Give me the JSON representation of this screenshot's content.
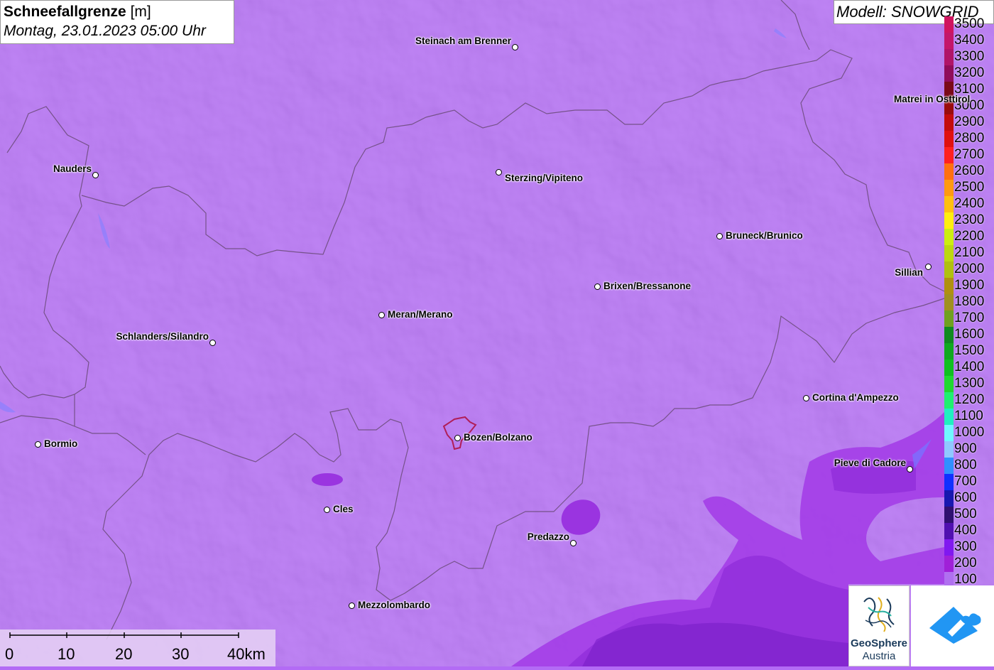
{
  "title": {
    "main": "Schneefallgrenze",
    "unit": "[m]",
    "datetime": "Montag, 23.01.2023 05:00 Uhr"
  },
  "model_label": "Modell: SNOWGRID",
  "legend": {
    "entries": [
      {
        "label": "3500",
        "color": "#d0145f"
      },
      {
        "label": "3400",
        "color": "#c4166a"
      },
      {
        "label": "3300",
        "color": "#b01468"
      },
      {
        "label": "3200",
        "color": "#900c5a"
      },
      {
        "label": "3100",
        "color": "#7a0a18"
      },
      {
        "label": "3000",
        "color": "#9a0c0c"
      },
      {
        "label": "2900",
        "color": "#c40c0c"
      },
      {
        "label": "2800",
        "color": "#e01010"
      },
      {
        "label": "2700",
        "color": "#ff2020"
      },
      {
        "label": "2600",
        "color": "#ff7010"
      },
      {
        "label": "2500",
        "color": "#ff9a10"
      },
      {
        "label": "2400",
        "color": "#ffc010"
      },
      {
        "label": "2300",
        "color": "#ffee10"
      },
      {
        "label": "2200",
        "color": "#ccee10"
      },
      {
        "label": "2100",
        "color": "#bcd810"
      },
      {
        "label": "2000",
        "color": "#b0c010"
      },
      {
        "label": "1900",
        "color": "#b09010"
      },
      {
        "label": "1800",
        "color": "#a09020"
      },
      {
        "label": "1700",
        "color": "#70a020"
      },
      {
        "label": "1600",
        "color": "#108a20"
      },
      {
        "label": "1500",
        "color": "#10a820"
      },
      {
        "label": "1400",
        "color": "#10c020"
      },
      {
        "label": "1300",
        "color": "#20d830"
      },
      {
        "label": "1200",
        "color": "#20f070"
      },
      {
        "label": "1100",
        "color": "#20f0c0"
      },
      {
        "label": "1000",
        "color": "#70f8ff"
      },
      {
        "label": "900",
        "color": "#90c8ff"
      },
      {
        "label": "800",
        "color": "#3090ff"
      },
      {
        "label": "700",
        "color": "#1030ff"
      },
      {
        "label": "600",
        "color": "#1818b0"
      },
      {
        "label": "500",
        "color": "#301070"
      },
      {
        "label": "400",
        "color": "#5010b0"
      },
      {
        "label": "300",
        "color": "#8018f0"
      },
      {
        "label": "200",
        "color": "#a020d8"
      },
      {
        "label": "100",
        "color": "#b070f0"
      }
    ]
  },
  "cities": [
    {
      "name": "Steinach am Brenner",
      "label_side": "left"
    },
    {
      "name": "Nauders",
      "label_side": "left"
    },
    {
      "name": "Sterzing/Vipiteno",
      "label_side": "right"
    },
    {
      "name": "Matrei in Osttirol",
      "label_side": "left"
    },
    {
      "name": "Bruneck/Brunico",
      "label_side": "right"
    },
    {
      "name": "Sillian",
      "label_side": "left"
    },
    {
      "name": "Brixen/Bressanone",
      "label_side": "right"
    },
    {
      "name": "Meran/Merano",
      "label_side": "right"
    },
    {
      "name": "Schlanders/Silandro",
      "label_side": "left"
    },
    {
      "name": "Cortina d'Ampezzo",
      "label_side": "right"
    },
    {
      "name": "Bormio",
      "label_side": "right"
    },
    {
      "name": "Bozen/Bolzano",
      "label_side": "right"
    },
    {
      "name": "Pieve di Cadore",
      "label_side": "left"
    },
    {
      "name": "Cles",
      "label_side": "right"
    },
    {
      "name": "Predazzo",
      "label_side": "left"
    },
    {
      "name": "Mezzolombardo",
      "label_side": "right"
    }
  ],
  "scale_bar": {
    "labels": [
      "0",
      "10",
      "20",
      "30",
      "40km"
    ]
  },
  "logos": {
    "geosphere_line1": "GeoSphere",
    "geosphere_line2": "Austria"
  },
  "colors": {
    "base_fill": "#b36bf5",
    "border_line": "#6a4a78"
  }
}
